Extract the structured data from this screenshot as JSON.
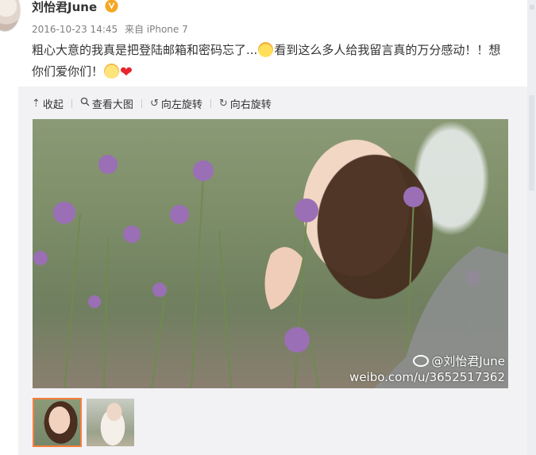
{
  "post": {
    "username": "刘怡君June",
    "vip_icon": "gold-v-verified-icon",
    "time": "2016-10-23 14:45",
    "source": "来自 iPhone 7",
    "text_1": "粗心大意的我真是把登陆邮箱和密码忘了...",
    "text_2": "看到这么多人给我留言真的万分感动！！想你们爱你们！",
    "emojis": [
      "laughing-tears-emoji",
      "kiss-emoji",
      "red-heart-emoji"
    ]
  },
  "toolbar": {
    "collapse": "收起",
    "view_large": "查看大图",
    "rotate_left": "向左旋转",
    "rotate_right": "向右旋转"
  },
  "photo": {
    "watermark_user": "@刘怡君June",
    "watermark_url": "weibo.com/u/3652517362"
  },
  "thumbnails": [
    {
      "label": "thumbnail-1",
      "selected": true
    },
    {
      "label": "thumbnail-2",
      "selected": false
    }
  ],
  "colors": {
    "selected_border": "#fa7d3c",
    "vip_gold": "#f5a623",
    "toolbar_bg": "#f2f2f5"
  }
}
